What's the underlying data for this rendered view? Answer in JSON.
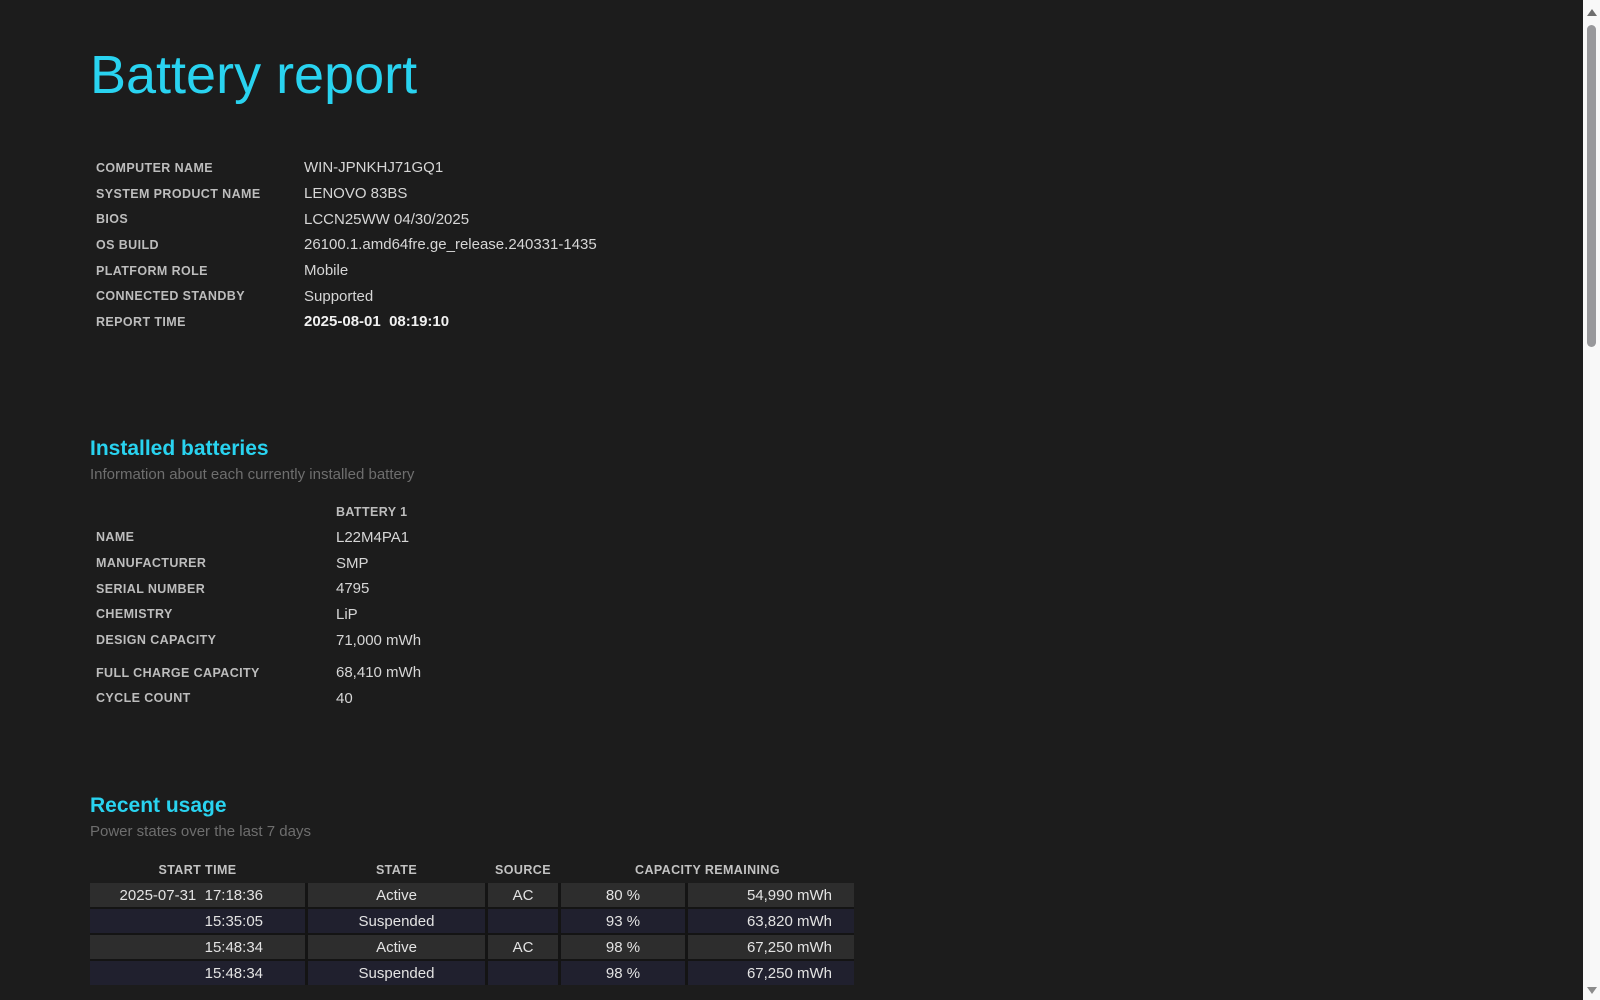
{
  "page": {
    "title": "Battery report",
    "accent_color": "#29d3f0",
    "background_color": "#1c1c1c",
    "row_active_color": "#2d2d2d",
    "row_suspended_color": "#20202e"
  },
  "system_info": {
    "rows": [
      {
        "label": "COMPUTER NAME",
        "value": "WIN-JPNKHJ71GQ1"
      },
      {
        "label": "SYSTEM PRODUCT NAME",
        "value": "LENOVO 83BS"
      },
      {
        "label": "BIOS",
        "value": "LCCN25WW 04/30/2025"
      },
      {
        "label": "OS BUILD",
        "value": "26100.1.amd64fre.ge_release.240331-1435"
      },
      {
        "label": "PLATFORM ROLE",
        "value": "Mobile"
      },
      {
        "label": "CONNECTED STANDBY",
        "value": "Supported"
      },
      {
        "label": "REPORT TIME",
        "value": "2025-08-01  08:19:10",
        "bold": true
      }
    ]
  },
  "installed_batteries": {
    "heading": "Installed batteries",
    "subtitle": "Information about each currently installed battery",
    "column_header": "BATTERY 1",
    "rows": [
      {
        "label": "NAME",
        "value": "L22M4PA1"
      },
      {
        "label": "MANUFACTURER",
        "value": "SMP"
      },
      {
        "label": "SERIAL NUMBER",
        "value": "4795"
      },
      {
        "label": "CHEMISTRY",
        "value": "LiP"
      },
      {
        "label": "DESIGN CAPACITY",
        "value": "71,000 mWh"
      },
      {
        "label": "FULL CHARGE CAPACITY",
        "value": "68,410 mWh",
        "gap_before": true
      },
      {
        "label": "CYCLE COUNT",
        "value": "40"
      }
    ]
  },
  "recent_usage": {
    "heading": "Recent usage",
    "subtitle": "Power states over the last 7 days",
    "columns": {
      "start_time": "START TIME",
      "state": "STATE",
      "source": "SOURCE",
      "capacity_remaining": "CAPACITY REMAINING"
    },
    "rows": [
      {
        "start_time": "2025-07-31  17:18:36",
        "state": "Active",
        "source": "AC",
        "percent": "80 %",
        "mwh": "54,990 mWh",
        "variant": "active"
      },
      {
        "start_time": "15:35:05",
        "state": "Suspended",
        "source": "",
        "percent": "93 %",
        "mwh": "63,820 mWh",
        "variant": "suspended"
      },
      {
        "start_time": "15:48:34",
        "state": "Active",
        "source": "AC",
        "percent": "98 %",
        "mwh": "67,250 mWh",
        "variant": "active"
      },
      {
        "start_time": "15:48:34",
        "state": "Suspended",
        "source": "",
        "percent": "98 %",
        "mwh": "67,250 mWh",
        "variant": "suspended"
      }
    ]
  }
}
